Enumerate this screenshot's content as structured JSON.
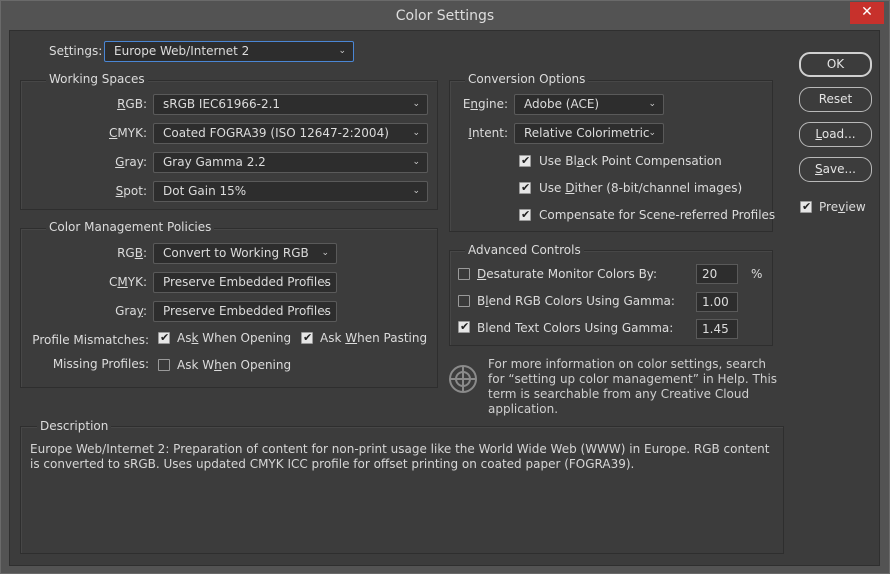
{
  "window": {
    "title": "Color Settings",
    "close_glyph": "✕"
  },
  "settings": {
    "label": "Settings:",
    "value": "Europe Web/Internet 2"
  },
  "working_spaces": {
    "title": "Working Spaces",
    "rgb": {
      "label": "RGB:",
      "value": "sRGB IEC61966-2.1"
    },
    "cmyk": {
      "label": "CMYK:",
      "value": "Coated FOGRA39 (ISO 12647-2:2004)"
    },
    "gray": {
      "label": "Gray:",
      "value": "Gray Gamma 2.2"
    },
    "spot": {
      "label": "Spot:",
      "value": "Dot Gain 15%"
    }
  },
  "policies": {
    "title": "Color Management Policies",
    "rgb": {
      "label": "RGB:",
      "value": "Convert to Working RGB"
    },
    "cmyk": {
      "label": "CMYK:",
      "value": "Preserve Embedded Profiles"
    },
    "gray": {
      "label": "Gray:",
      "value": "Preserve Embedded Profiles"
    },
    "mismatches_label": "Profile Mismatches:",
    "ask_opening": "Ask When Opening",
    "ask_pasting": "Ask When Pasting",
    "missing_label": "Missing Profiles:",
    "missing_ask_opening": "Ask When Opening"
  },
  "conversion": {
    "title": "Conversion Options",
    "engine": {
      "label": "Engine:",
      "value": "Adobe (ACE)"
    },
    "intent": {
      "label": "Intent:",
      "value": "Relative Colorimetric"
    },
    "black_point": "Use Black Point Compensation",
    "dither": "Use Dither (8-bit/channel images)",
    "scene_referred": "Compensate for Scene-referred Profiles"
  },
  "advanced": {
    "title": "Advanced Controls",
    "desaturate": {
      "label": "Desaturate Monitor Colors By:",
      "value": "20",
      "unit": "%"
    },
    "blend_rgb": {
      "label": "Blend RGB Colors Using Gamma:",
      "value": "1.00"
    },
    "blend_text": {
      "label": "Blend Text Colors Using Gamma:",
      "value": "1.45"
    }
  },
  "info": {
    "text": "For more information on color settings, search for “setting up color management” in Help. This term is searchable from any Creative Cloud application."
  },
  "description": {
    "title": "Description",
    "text": "Europe Web/Internet 2:  Preparation of content for non-print usage like the World Wide Web (WWW) in Europe. RGB content is converted to sRGB. Uses updated CMYK ICC profile for offset printing on coated paper (FOGRA39)."
  },
  "buttons": {
    "ok": "OK",
    "reset": "Reset",
    "load": "Load...",
    "save": "Save...",
    "preview": "Preview"
  },
  "colors": {
    "close_red": "#c7312c",
    "focus_blue": "#4a86d4"
  }
}
